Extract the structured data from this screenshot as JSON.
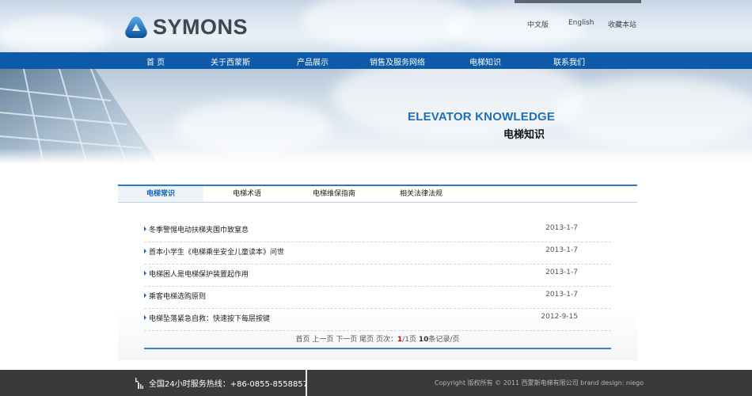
{
  "brand": {
    "name": "SYMONS"
  },
  "toplinks": [
    "中文版",
    "English",
    "收藏本站"
  ],
  "nav": [
    "首 页",
    "关于西蒙斯",
    "产品展示",
    "销售及服务网络",
    "电梯知识",
    "联系我们"
  ],
  "banner": {
    "title_en": "ELEVATOR KNOWLEDGE",
    "title_zh": "电梯知识"
  },
  "tabs": [
    {
      "label": "电梯常识",
      "active": true
    },
    {
      "label": "电梯术语",
      "active": false
    },
    {
      "label": "电梯维保指南",
      "active": false
    },
    {
      "label": "相关法律法规",
      "active": false
    }
  ],
  "articles": [
    {
      "title": "冬季警惕电动扶梯夹围巾致窒息",
      "date": "2013-1-7"
    },
    {
      "title": "首本小学生《电梯乘坐安全儿童读本》问世",
      "date": "2013-1-7"
    },
    {
      "title": "电梯困人是电梯保护装置起作用",
      "date": "2013-1-7"
    },
    {
      "title": "乘客电梯选购原则",
      "date": "2013-1-7"
    },
    {
      "title": "电梯坠落紧急自救：快速按下每层按键",
      "date": "2012-9-15"
    }
  ],
  "pager": {
    "links": "首页 上一页 下一页 尾页 页次：",
    "current": "1",
    "total": "/1页",
    "per_page": "10",
    "per_page_suffix": "条记录/页"
  },
  "footer": {
    "hotline": "全国24小时服务热线：+86-0855-8558857",
    "copyright": "Copyright 版权所有 © 2011 西蒙斯电梯有限公司 brand design: niego"
  },
  "colors": {
    "nav": "#0d5aa8",
    "accent": "#1e6fb8",
    "footer": "#3a3a3a",
    "pager_current": "#d40000"
  }
}
